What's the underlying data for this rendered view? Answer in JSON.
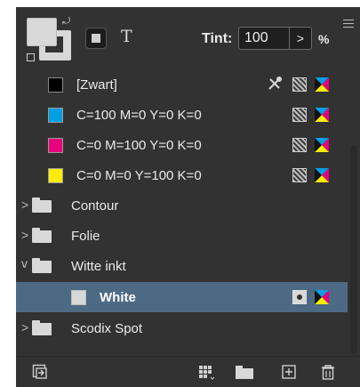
{
  "toolbar": {
    "text_button_label": "T",
    "tint_label": "Tint:",
    "tint_value": "100",
    "tint_arrow": ">",
    "tint_unit": "%"
  },
  "swatches": [
    {
      "label": "[Zwart]",
      "color": "#000000",
      "type": "registration"
    },
    {
      "label": "C=100 M=0 Y=0 K=0",
      "color": "#009fe3",
      "type": "process"
    },
    {
      "label": "C=0 M=100 Y=0 K=0",
      "color": "#e6007e",
      "type": "process"
    },
    {
      "label": "C=0 M=0 Y=100 K=0",
      "color": "#ffed00",
      "type": "process"
    }
  ],
  "groups": [
    {
      "label": "Contour",
      "expanded": false
    },
    {
      "label": "Folie",
      "expanded": false
    },
    {
      "label": "Witte inkt",
      "expanded": true
    },
    {
      "label": "Scodix Spot",
      "expanded": false
    }
  ],
  "group_child": {
    "label": "White",
    "color": "#d8d8d8",
    "type": "spot",
    "selected": true
  },
  "icons": {
    "collapsed_caret": ">",
    "expanded_caret": "v"
  },
  "colors": {
    "panel_bg": "#323232",
    "selection": "#4d6a84"
  }
}
